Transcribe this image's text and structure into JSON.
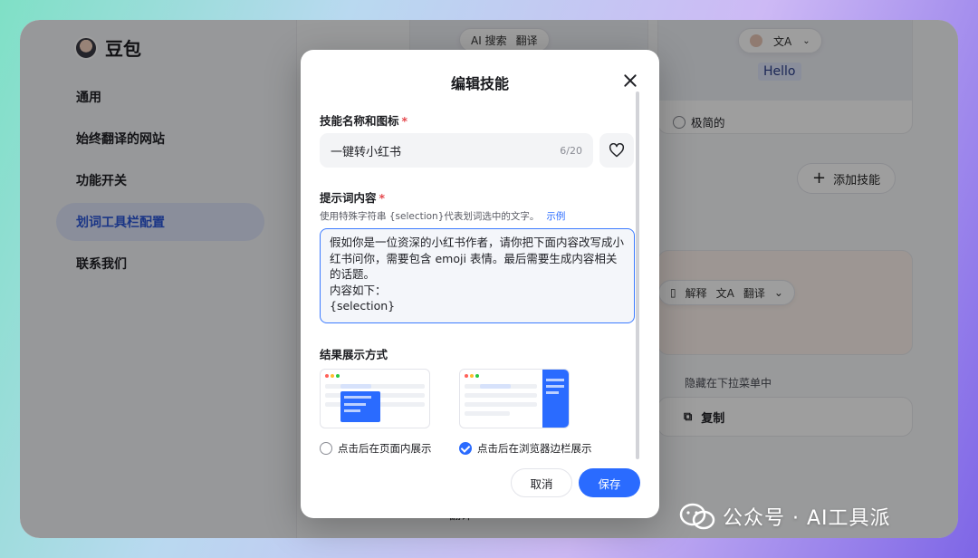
{
  "brand": {
    "name": "豆包"
  },
  "sidebar": {
    "items": [
      {
        "label": "通用",
        "active": false
      },
      {
        "label": "始终翻译的网站",
        "active": false
      },
      {
        "label": "功能开关",
        "active": false
      },
      {
        "label": "划词工具栏配置",
        "active": true
      },
      {
        "label": "联系我们",
        "active": false
      }
    ]
  },
  "background": {
    "toolbar_top": {
      "search_label": "AI 搜索",
      "translate_label": "翻译"
    },
    "hello_text": "Hello",
    "style_option": "极简的",
    "add_skill_label": "添加技能",
    "toolbar_mid": {
      "explain_label": "解释",
      "translate_label": "翻译"
    },
    "hidden_hint": "隐藏在下拉菜单中",
    "copy_label": "复制",
    "bottom_item_label": "翻译"
  },
  "modal": {
    "title": "编辑技能",
    "name_section_label": "技能名称和图标",
    "name_value": "一键转小红书",
    "name_counter": "6/20",
    "prompt_section_label": "提示词内容",
    "prompt_hint": "使用特殊字符串 {selection}代表划词选中的文字。",
    "prompt_hint_link": "示例",
    "prompt_text": "假如你是一位资深的小红书作者，请你把下面内容改写成小红书问你，需要包含 emoji 表情。最后需要生成内容相关的话题。\n内容如下：\n{selection}",
    "display_section_label": "结果展示方式",
    "option_in_page": "点击后在页面内展示",
    "option_sidebar": "点击后在浏览器边栏展示",
    "selected_option": "sidebar",
    "cancel_label": "取消",
    "save_label": "保存"
  },
  "watermark": {
    "text": "公众号 · AI工具派"
  },
  "colors": {
    "accent": "#2a6bff",
    "required": "#e5484d"
  }
}
